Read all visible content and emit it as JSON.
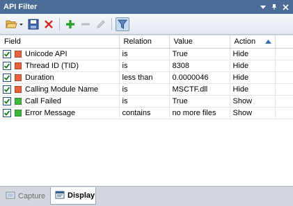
{
  "window": {
    "title": "API Filter"
  },
  "toolbar": {
    "open_icon": "folder-open-icon",
    "save_icon": "save-icon",
    "delete_icon": "delete-icon",
    "add_icon": "add-icon",
    "remove_icon": "remove-icon",
    "edit_icon": "edit-icon",
    "filter_icon": "filter-icon"
  },
  "table": {
    "columns": [
      "Field",
      "Relation",
      "Value",
      "Action"
    ],
    "rows": [
      {
        "checked": true,
        "color": "#e8613a",
        "field": "Unicode API",
        "relation": "is",
        "value": "True",
        "action": "Hide"
      },
      {
        "checked": true,
        "color": "#e8613a",
        "field": "Thread ID (TID)",
        "relation": "is",
        "value": "8308",
        "action": "Hide"
      },
      {
        "checked": true,
        "color": "#e8613a",
        "field": "Duration",
        "relation": "less than",
        "value": "0.0000046",
        "action": "Hide"
      },
      {
        "checked": true,
        "color": "#e8613a",
        "field": "Calling Module Name",
        "relation": "is",
        "value": "MSCTF.dll",
        "action": "Hide"
      },
      {
        "checked": true,
        "color": "#3fb83f",
        "field": "Call Failed",
        "relation": "is",
        "value": "True",
        "action": "Show"
      },
      {
        "checked": true,
        "color": "#3fb83f",
        "field": "Error Message",
        "relation": "contains",
        "value": "no more files",
        "action": "Show"
      }
    ]
  },
  "tabs": [
    {
      "label": "Capture",
      "active": false
    },
    {
      "label": "Display",
      "active": true
    }
  ],
  "colors": {
    "titlebar": "#4a6c97",
    "hide": "#e8613a",
    "show": "#3fb83f"
  }
}
